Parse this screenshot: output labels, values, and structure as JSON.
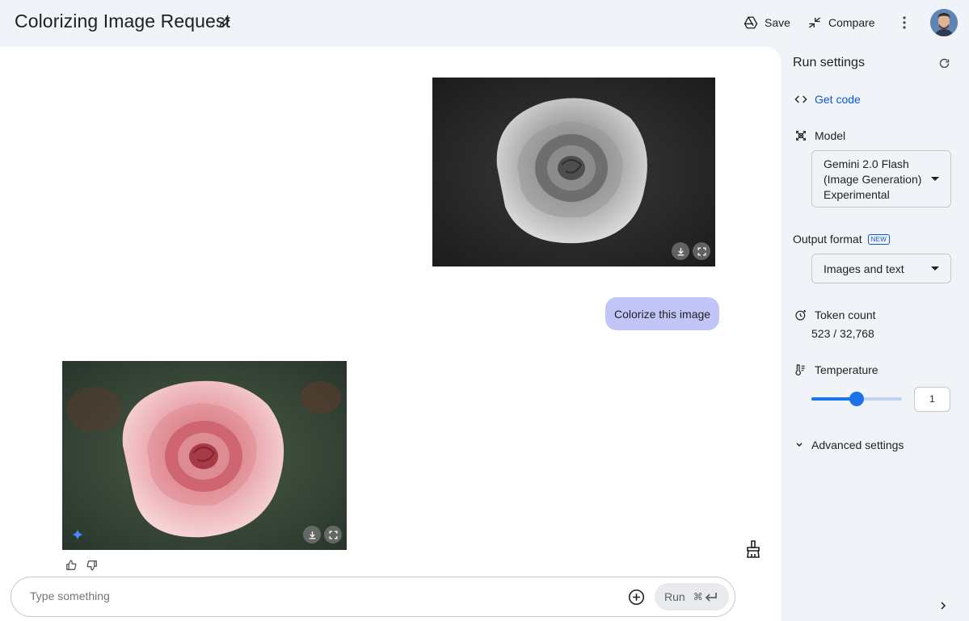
{
  "header": {
    "title": "Colorizing Image Request",
    "save_label": "Save",
    "compare_label": "Compare"
  },
  "chat": {
    "user_message": "Colorize this image",
    "input_placeholder": "Type something",
    "run_label": "Run",
    "run_shortcut": "⌘"
  },
  "sidebar": {
    "title": "Run settings",
    "get_code_label": "Get code",
    "model_label": "Model",
    "model_value": "Gemini 2.0 Flash (Image Generation) Experimental",
    "output_format_label": "Output format",
    "output_format_badge": "NEW",
    "output_format_value": "Images and text",
    "token_count_label": "Token count",
    "token_count_value": "523 / 32,768",
    "temperature_label": "Temperature",
    "temperature_value": "1",
    "temperature_fraction": 0.5,
    "advanced_label": "Advanced settings"
  },
  "colors": {
    "accent": "#0b57d0",
    "slider": "#1a73e8",
    "user_bubble": "#c2c5f7",
    "background": "#f0f4f9"
  }
}
